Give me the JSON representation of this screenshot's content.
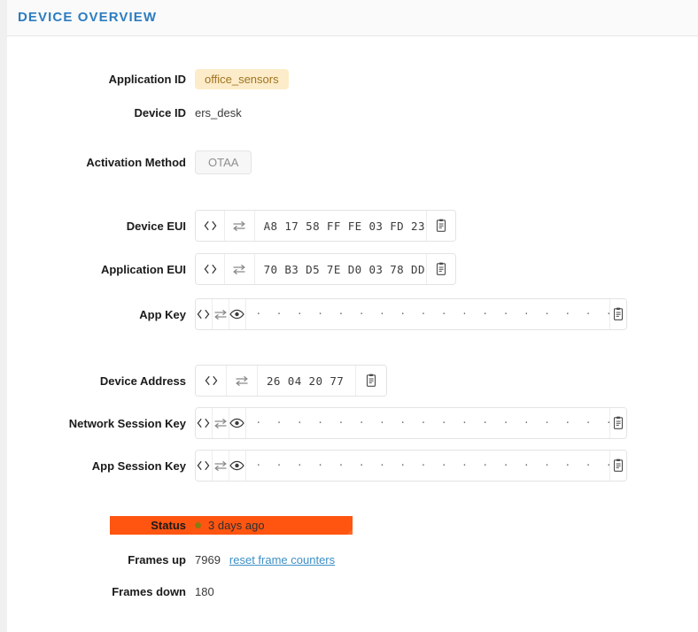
{
  "header": {
    "title": "DEVICE OVERVIEW",
    "accent_color": "#2c7cc0"
  },
  "fields": {
    "application_id": {
      "label": "Application ID",
      "value": "office_sensors",
      "badge_bg": "#fcecc9",
      "badge_fg": "#a07320"
    },
    "device_id": {
      "label": "Device ID",
      "value": "ers_desk"
    },
    "activation_method": {
      "label": "Activation Method",
      "value": "OTAA"
    },
    "device_eui": {
      "label": "Device EUI",
      "value": "A8 17 58 FF FE 03 FD 23"
    },
    "application_eui": {
      "label": "Application EUI",
      "value": "70 B3 D5 7E D0 03 78 DD"
    },
    "app_key": {
      "label": "App Key",
      "value": "· · · · · · · · · · · · · · · · · · · · · · · · · · · · · · · ·"
    },
    "device_address": {
      "label": "Device Address",
      "value": "26 04 20 77"
    },
    "network_session_key": {
      "label": "Network Session Key",
      "value": "· · · · · · · · · · · · · · · · · · · · · · · · · · · · · · · ·"
    },
    "app_session_key": {
      "label": "App Session Key",
      "value": "· · · · · · · · · · · · · · · · · · · · · · · · · · · · · · · ·"
    },
    "status": {
      "label": "Status",
      "value": "3 days ago",
      "highlight_color": "#ff5511",
      "dot_color": "#8a7a12"
    },
    "frames_up": {
      "label": "Frames up",
      "value": "7969",
      "link_label": "reset frame counters"
    },
    "frames_down": {
      "label": "Frames down",
      "value": "180"
    }
  },
  "icons": {
    "code": "code-brackets-icon",
    "swap": "swap-arrows-icon",
    "eye": "eye-icon",
    "copy": "clipboard-copy-icon"
  }
}
